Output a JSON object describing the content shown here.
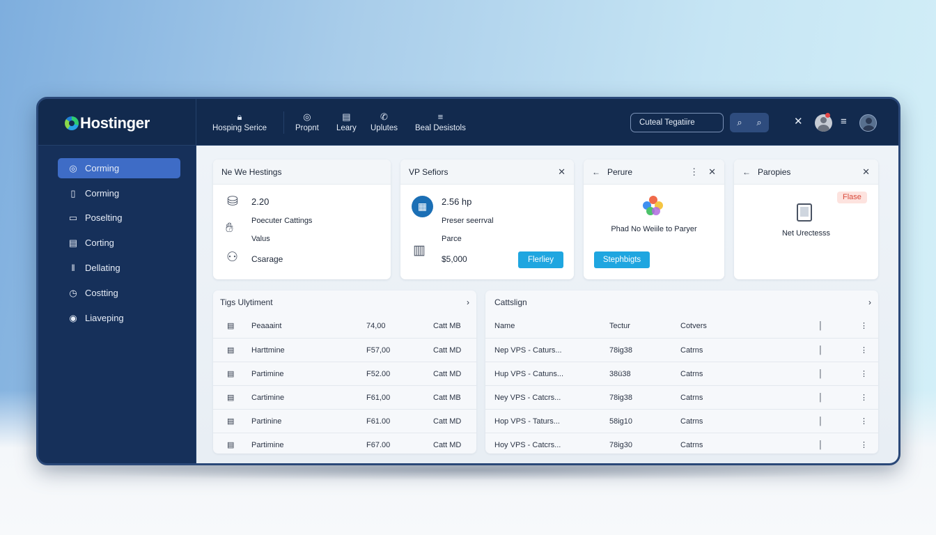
{
  "brand": {
    "name": "Hostinger"
  },
  "topnav": [
    {
      "label": "Hosping  Serice",
      "icon": "lock-icon"
    },
    {
      "label": "Propnt",
      "icon": "globe-icon"
    },
    {
      "label": "Leary",
      "icon": "grid-icon"
    },
    {
      "label": "Uplutes",
      "icon": "phone-icon"
    },
    {
      "label": "Beal Desistols",
      "icon": "database-icon"
    }
  ],
  "search": {
    "placeholder": "Cuteal Tegatiire"
  },
  "sidebar": {
    "items": [
      {
        "label": "Corming",
        "icon": "dashboard-icon",
        "active": true
      },
      {
        "label": "Corming",
        "icon": "clipboard-icon"
      },
      {
        "label": "Poselting",
        "icon": "folder-icon"
      },
      {
        "label": "Corting",
        "icon": "list-icon"
      },
      {
        "label": "Dellating",
        "icon": "book-icon"
      },
      {
        "label": "Costting",
        "icon": "clock-icon"
      },
      {
        "label": "Liaveping",
        "icon": "support-icon"
      }
    ]
  },
  "cards": {
    "hosting": {
      "title": "Ne We Hestings",
      "value": "2.20",
      "line1": "Poecuter Cattings",
      "line2": "Valus",
      "line3": "Csarage"
    },
    "vps": {
      "title": "VP Sefiors",
      "value": "2.56 hp",
      "line1": "Preser seerrval",
      "line2": "Parce",
      "price": "$5,000",
      "button": "Flerliey"
    },
    "perure": {
      "title": "Perure",
      "text": "Phad No Weiile to Paryer",
      "button": "Stephbigts"
    },
    "paropies": {
      "title": "Paropies",
      "badge": "Flase",
      "text": "Net Urectesss"
    }
  },
  "left_table": {
    "title": "Tigs Ulytiment",
    "rows": [
      [
        "Peaaaint",
        "74,00",
        "Catt MB"
      ],
      [
        "Harttmine",
        "F57,00",
        "Catt MD"
      ],
      [
        "Partimine",
        "F52.00",
        "Catt MD"
      ],
      [
        "Cartimine",
        "F61,00",
        "Catt MB"
      ],
      [
        "Partinine",
        "F61.00",
        "Catt MD"
      ],
      [
        "Partimine",
        "F67.00",
        "Catt MD"
      ]
    ]
  },
  "right_table": {
    "title": "Cattslign",
    "columns": [
      "Name",
      "Tectur",
      "Cotvers"
    ],
    "rows": [
      [
        "Nep VPS - Caturs...",
        "78ig38",
        "Catrns"
      ],
      [
        "Hup VPS - Catuns...",
        "38ü38",
        "Catrns"
      ],
      [
        "Ney VPS - Catcrs...",
        "78ig38",
        "Catrns"
      ],
      [
        "Hop VPS - Taturs...",
        "58ig10",
        "Catrns"
      ],
      [
        "Hoy VPS - Catcrs...",
        "78ig30",
        "Catrns"
      ]
    ]
  },
  "colors": {
    "frame": "#16305a",
    "accent": "#3e6cc6",
    "button": "#1fa6e0",
    "badge": "#d8493a"
  }
}
